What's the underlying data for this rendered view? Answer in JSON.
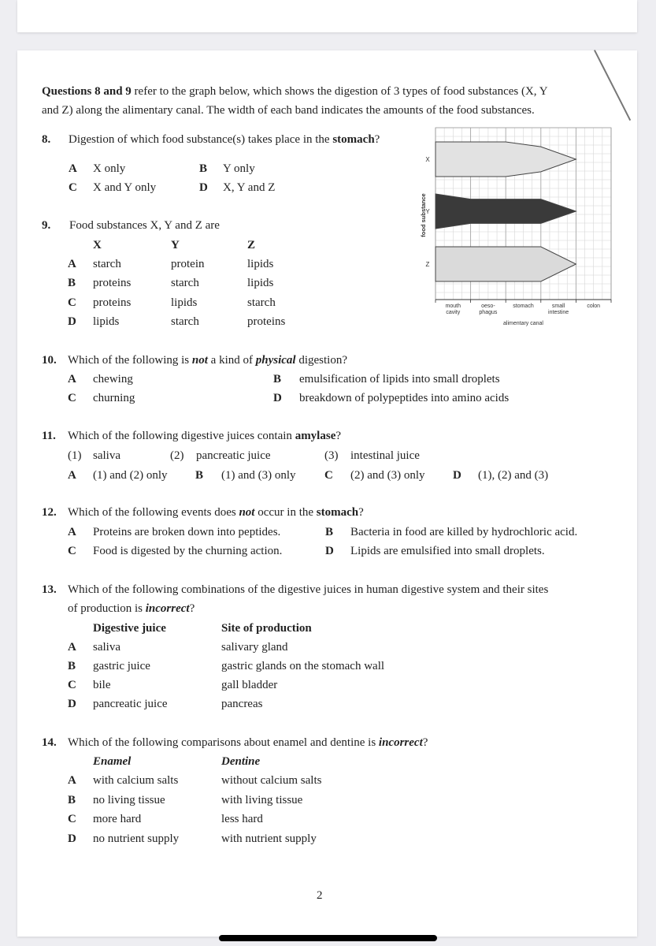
{
  "intro": {
    "lead_bold": "Questions 8 and 9",
    "line1_rest": " refer to the graph below, which shows the digestion of 3 types of food substances (X, Y",
    "line2": "and Z) along the alimentary canal. The width of each band indicates the amounts of the food substances."
  },
  "q8": {
    "number": "8.",
    "text_before": "Digestion of which food substance(s) takes place in the ",
    "text_bold": "stomach",
    "text_after": "?",
    "options": [
      {
        "label": "A",
        "text": "X only"
      },
      {
        "label": "B",
        "text": "Y only"
      },
      {
        "label": "C",
        "text": "X and Y only"
      },
      {
        "label": "D",
        "text": "X, Y and Z"
      }
    ]
  },
  "q9": {
    "number": "9.",
    "text": "Food substances X, Y and Z are",
    "headers": [
      "X",
      "Y",
      "Z"
    ],
    "rows": [
      {
        "label": "A",
        "cells": [
          "starch",
          "protein",
          "lipids"
        ]
      },
      {
        "label": "B",
        "cells": [
          "proteins",
          "starch",
          "lipids"
        ]
      },
      {
        "label": "C",
        "cells": [
          "proteins",
          "lipids",
          "starch"
        ]
      },
      {
        "label": "D",
        "cells": [
          "lipids",
          "starch",
          "proteins"
        ]
      }
    ]
  },
  "chart_data": {
    "type": "area",
    "title": "",
    "xlabel": "alimentary canal",
    "ylabel": "food substance",
    "categories": [
      "mouth cavity",
      "oeso- phagus",
      "stomach",
      "small intestine",
      "colon"
    ],
    "category_lines": [
      [
        "mouth",
        "cavity"
      ],
      [
        "oeso-",
        "phagus"
      ],
      [
        "stomach"
      ],
      [
        "small",
        "intestine"
      ],
      [
        "colon"
      ]
    ],
    "grid": true,
    "boundaries": [
      "mouth cavity start",
      "oesophagus start",
      "stomach start",
      "small intestine start",
      "colon start",
      "end"
    ],
    "series": [
      {
        "name": "X",
        "fill": "#e2e2e2",
        "relative_width_at_boundaries": [
          1.0,
          1.0,
          1.0,
          0.72,
          0.0
        ]
      },
      {
        "name": "Y",
        "fill": "#3a3a3a",
        "relative_width_at_boundaries": [
          1.0,
          0.7,
          0.7,
          0.7,
          0.0
        ]
      },
      {
        "name": "Z",
        "fill": "#dadada",
        "relative_width_at_boundaries": [
          1.0,
          1.0,
          1.0,
          1.0,
          0.0
        ]
      }
    ]
  },
  "q10": {
    "number": "10.",
    "t1": "Which of the following is ",
    "t2": "not",
    "t3": " a kind of ",
    "t4": "physical",
    "t5": " digestion?",
    "options": [
      {
        "label": "A",
        "text": "chewing"
      },
      {
        "label": "B",
        "text": "emulsification of lipids into small droplets"
      },
      {
        "label": "C",
        "text": "churning"
      },
      {
        "label": "D",
        "text": "breakdown of polypeptides into amino acids"
      }
    ]
  },
  "q11": {
    "number": "11.",
    "text_before": "Which of the following digestive juices contain ",
    "text_bold": "amylase",
    "text_after": "?",
    "items": [
      {
        "label": "(1)",
        "text": "saliva"
      },
      {
        "label": "(2)",
        "text": "pancreatic juice"
      },
      {
        "label": "(3)",
        "text": "intestinal juice"
      }
    ],
    "options": [
      {
        "label": "A",
        "text": "(1) and (2) only"
      },
      {
        "label": "B",
        "text": "(1) and (3) only"
      },
      {
        "label": "C",
        "text": "(2) and (3) only"
      },
      {
        "label": "D",
        "text": "(1), (2) and (3)"
      }
    ]
  },
  "q12": {
    "number": "12.",
    "t1": "Which of the following events does ",
    "t2": "not",
    "t3": " occur in the ",
    "t4": "stomach",
    "t5": "?",
    "options": [
      {
        "label": "A",
        "text": "Proteins are broken down into peptides."
      },
      {
        "label": "B",
        "text": "Bacteria in food are killed by hydrochloric acid."
      },
      {
        "label": "C",
        "text": "Food is digested by the churning action."
      },
      {
        "label": "D",
        "text": "Lipids are emulsified into small droplets."
      }
    ]
  },
  "q13": {
    "number": "13.",
    "line1": "Which of the following combinations of the digestive juices in human digestive system and their sites",
    "line2_before": "of production is ",
    "line2_bi": "incorrect",
    "line2_after": "?",
    "headers": [
      "Digestive juice",
      "Site of production"
    ],
    "rows": [
      {
        "label": "A",
        "cells": [
          "saliva",
          "salivary gland"
        ]
      },
      {
        "label": "B",
        "cells": [
          "gastric juice",
          "gastric glands on the stomach wall"
        ]
      },
      {
        "label": "C",
        "cells": [
          "bile",
          "gall bladder"
        ]
      },
      {
        "label": "D",
        "cells": [
          "pancreatic juice",
          "pancreas"
        ]
      }
    ]
  },
  "q14": {
    "number": "14.",
    "text_before": "Which of the following comparisons about enamel and dentine is ",
    "text_bi": "incorrect",
    "text_after": "?",
    "headers": [
      "Enamel",
      "Dentine"
    ],
    "rows": [
      {
        "label": "A",
        "cells": [
          "with calcium salts",
          "without calcium salts"
        ]
      },
      {
        "label": "B",
        "cells": [
          "no living tissue",
          "with living tissue"
        ]
      },
      {
        "label": "C",
        "cells": [
          "more hard",
          "less hard"
        ]
      },
      {
        "label": "D",
        "cells": [
          "no nutrient supply",
          "with nutrient supply"
        ]
      }
    ]
  },
  "page_number": "2"
}
